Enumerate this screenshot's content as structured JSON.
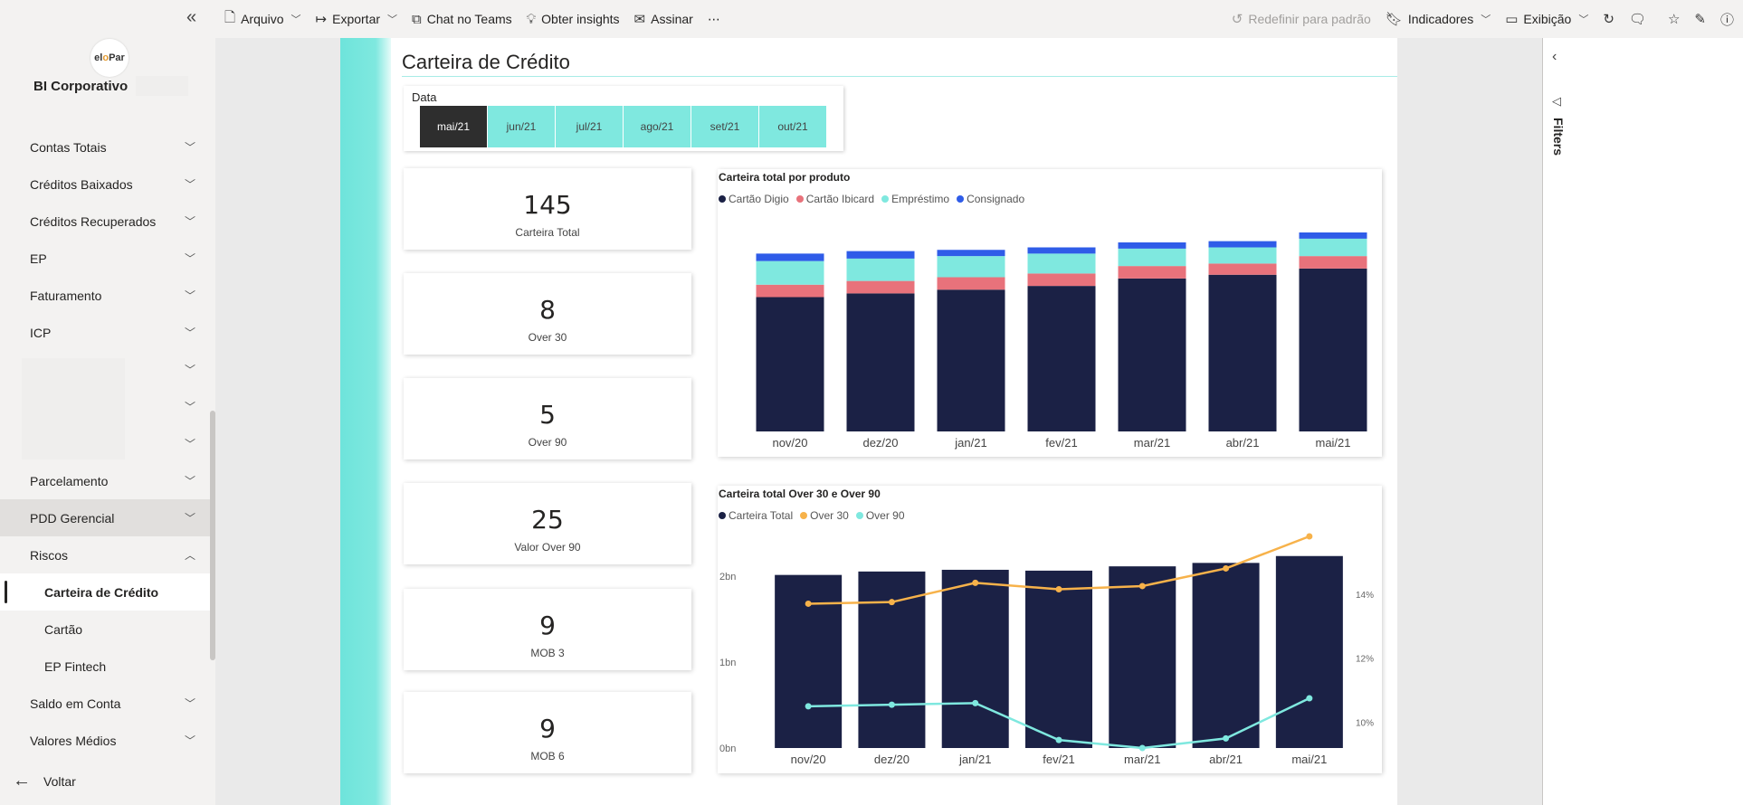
{
  "toolbar": {
    "file": "Arquivo",
    "export": "Exportar",
    "teams": "Chat no Teams",
    "insights": "Obter insights",
    "subscribe": "Assinar",
    "more": "⋯",
    "reset": "Redefinir para padrão",
    "bookmarks": "Indicadores",
    "view": "Exibição"
  },
  "sidebar": {
    "logo_a": "el",
    "logo_b": "o",
    "logo_c": "Par",
    "workspace": "BI Corporativo",
    "items": [
      {
        "label": "Contas Totais"
      },
      {
        "label": "Créditos Baixados"
      },
      {
        "label": "Créditos Recuperados"
      },
      {
        "label": "EP"
      },
      {
        "label": "Faturamento"
      },
      {
        "label": "ICP"
      },
      {
        "label": ""
      },
      {
        "label": ""
      },
      {
        "label": ""
      },
      {
        "label": "Parcelamento"
      },
      {
        "label": "PDD Gerencial"
      },
      {
        "label": "Riscos"
      },
      {
        "label": "Carteira de Crédito"
      },
      {
        "label": "Cartão"
      },
      {
        "label": "EP Fintech"
      },
      {
        "label": "Saldo em Conta"
      },
      {
        "label": "Valores Médios"
      }
    ],
    "back": "Voltar"
  },
  "report": {
    "title": "Carteira de Crédito",
    "slicer": {
      "label": "Data",
      "options": [
        "mai/21",
        "jun/21",
        "jul/21",
        "ago/21",
        "set/21",
        "out/21"
      ],
      "selected": "mai/21"
    },
    "cards": [
      {
        "value": "145",
        "label": "Carteira Total"
      },
      {
        "value": "8",
        "label": "Over 30"
      },
      {
        "value": "5",
        "label": "Over 90"
      },
      {
        "value": "25",
        "label": "Valor Over 90"
      },
      {
        "value": "9",
        "label": "MOB 3"
      },
      {
        "value": "9",
        "label": "MOB 6"
      }
    ]
  },
  "filters": {
    "label": "Filters"
  },
  "colors": {
    "navy": "#1b2145",
    "red": "#e8727b",
    "teal": "#7fe8df",
    "blue": "#2f5ce8",
    "orange": "#f7b24a"
  },
  "chart_data": [
    {
      "type": "bar",
      "stacked": true,
      "title": "Carteira total por produto",
      "categories": [
        "nov/20",
        "dez/20",
        "jan/21",
        "fev/21",
        "mar/21",
        "abr/21",
        "mai/21"
      ],
      "series": [
        {
          "name": "Cartão Digio",
          "color": "#1b2145",
          "values": [
            108,
            111,
            114,
            117,
            123,
            126,
            131
          ]
        },
        {
          "name": "Cartão Ibicard",
          "color": "#e8727b",
          "values": [
            10,
            10,
            10,
            10,
            10,
            9,
            10
          ]
        },
        {
          "name": "Empréstimo",
          "color": "#7fe8df",
          "values": [
            19,
            18,
            17,
            16,
            14,
            13,
            14
          ]
        },
        {
          "name": "Consignado",
          "color": "#2f5ce8",
          "values": [
            6,
            6,
            5,
            5,
            5,
            5,
            5
          ]
        }
      ],
      "ylim": [
        0,
        160
      ],
      "legend": "top-left"
    },
    {
      "type": "bar",
      "title": "Carteira total Over 30 e Over 90",
      "categories": [
        "nov/20",
        "dez/20",
        "jan/21",
        "fev/21",
        "mar/21",
        "abr/21",
        "mai/21"
      ],
      "series": [
        {
          "name": "Carteira Total",
          "color": "#1b2145",
          "kind": "bar",
          "axis": "left",
          "values": [
            1.93,
            1.97,
            1.99,
            1.98,
            2.03,
            2.07,
            2.15
          ]
        },
        {
          "name": "Over 30",
          "color": "#f7b24a",
          "kind": "line",
          "axis": "right",
          "values": [
            13.7,
            13.75,
            14.35,
            14.15,
            14.25,
            14.8,
            15.8
          ]
        },
        {
          "name": "Over 90",
          "color": "#7fe8df",
          "kind": "line",
          "axis": "right",
          "values": [
            10.5,
            10.55,
            10.6,
            9.45,
            9.2,
            9.5,
            10.75
          ]
        }
      ],
      "y_left": {
        "ticks": [
          "0bn",
          "1bn",
          "2bn"
        ],
        "ylim": [
          0,
          2.0
        ]
      },
      "y_right": {
        "ticks": [
          "10%",
          "12%",
          "14%"
        ],
        "ylim": [
          9.2,
          15.8
        ]
      },
      "legend": "top-left"
    }
  ]
}
